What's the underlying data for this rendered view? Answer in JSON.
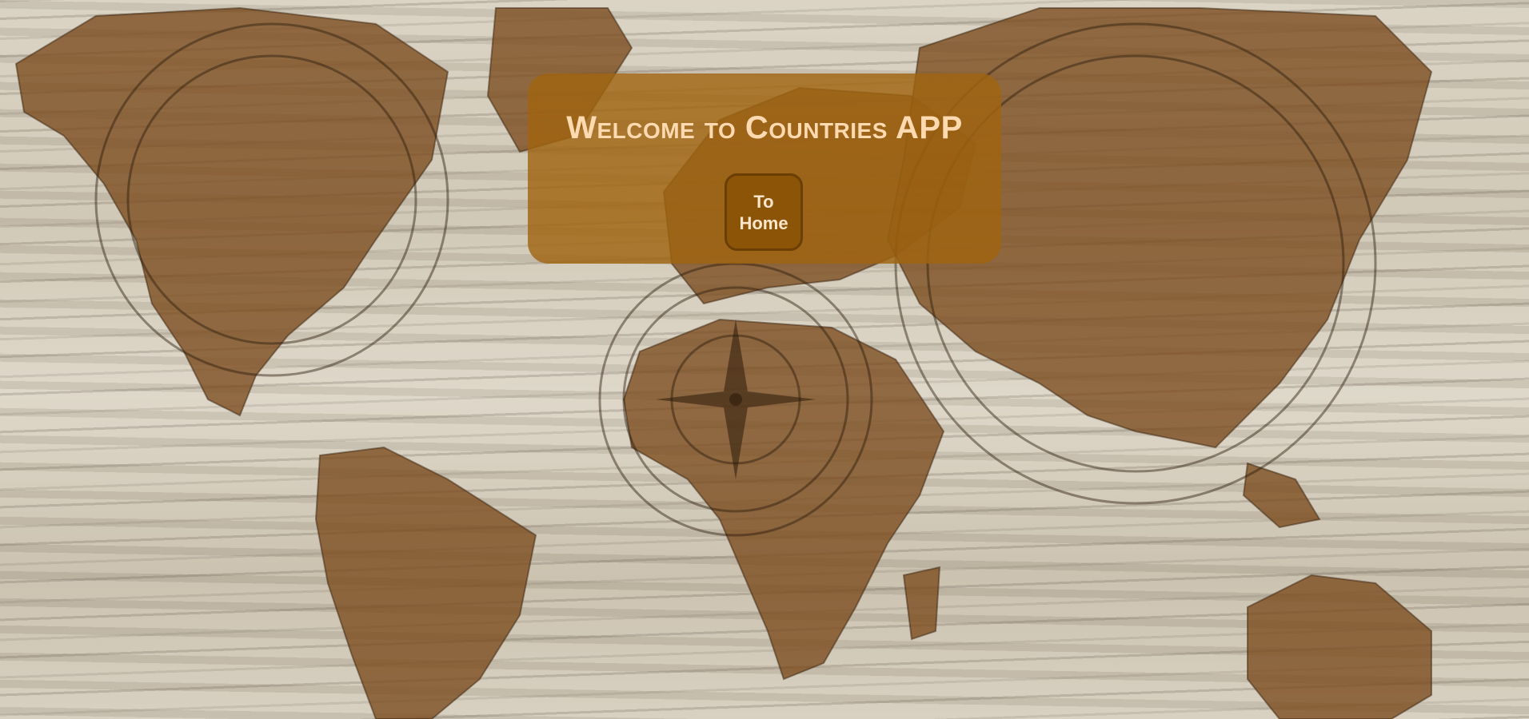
{
  "page": {
    "background": "world-map-on-wood"
  },
  "welcome_card": {
    "title": "Welcome to Countries APP",
    "home_button_label": "To Home"
  },
  "colors": {
    "card": "#a0640f",
    "title_text": "#ffd9b0",
    "button": "#8b5406",
    "button_text": "#fde6cc"
  }
}
